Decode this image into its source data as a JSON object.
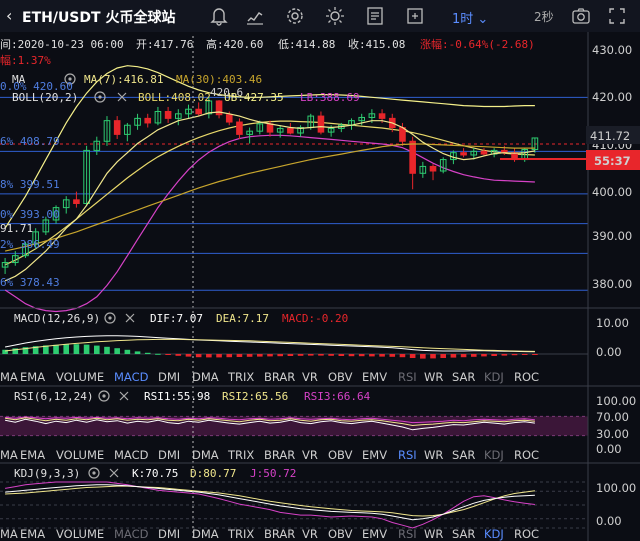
{
  "header": {
    "back_icon": "chevron-left-icon",
    "title": "ETH/USDT 火币全球站",
    "interval": "1时",
    "refresh": "2秒",
    "icons": [
      "bell-icon",
      "edit-icon",
      "chart-icon",
      "gear-icon",
      "brightness-icon",
      "list-icon",
      "fullscreen-icon",
      "camera-icon"
    ]
  },
  "info": {
    "datetime": "间:2020-10-23 06:00",
    "open": "开:417.76",
    "high": "高:420.60",
    "low": "低:414.88",
    "close": "收:415.08",
    "change": "涨幅:-0.64%(-2.68)",
    "amplitude": "幅:1.37%"
  },
  "legend": {
    "ma_label": "MA",
    "ma7": "MA(7):416.81",
    "ma30": "MA(30):403.46",
    "boll_label": "BOLL(20,2)",
    "boll": "BOLL:408.02",
    "ub": "UB:427.35",
    "lb": "LB:388.69",
    "fib": [
      "0.0% 420.60",
      "6% 408.79",
      "8% 399.51",
      "0% 393.00",
      "2% 386.49",
      "6% 378.43"
    ],
    "low_mark": "91.71",
    "high_mark": "420.6"
  },
  "price_axis": {
    "ticks": [
      "430.00",
      "420.00",
      "410.00",
      "400.00",
      "390.00",
      "380.00"
    ],
    "current": "411.72",
    "countdown": "55:37"
  },
  "macd": {
    "label": "MACD(12,26,9)",
    "dif": "DIF:7.07",
    "dea": "DEA:7.17",
    "macd": "MACD:-0.20",
    "ticks": [
      "10.00",
      "0.00"
    ]
  },
  "tabs": [
    "MA",
    "EMA",
    "VOLUME",
    "MACD",
    "DMI",
    "DMA",
    "TRIX",
    "BRAR",
    "VR",
    "OBV",
    "EMV",
    "RSI",
    "WR",
    "SAR",
    "KDJ",
    "ROC"
  ],
  "rsi": {
    "label": "RSI(6,12,24)",
    "rsi1": "RSI1:55.98",
    "rsi2": "RSI2:65.56",
    "rsi3": "RSI3:66.64",
    "ticks": [
      "100.00",
      "70.00",
      "30.00",
      "0.00"
    ]
  },
  "kdj": {
    "label": "KDJ(9,3,3)",
    "k": "K:70.75",
    "d": "D:80.77",
    "j": "J:50.72",
    "ticks": [
      "100.00",
      "0.00"
    ]
  },
  "colors": {
    "up": "#2ecc71",
    "down": "#e8262b",
    "ma7": "#f0e68c",
    "ma30": "#c7a52d",
    "boll": "#e8d86a",
    "ub": "#f5f08a",
    "lb": "#d642c7",
    "fib": "#2f5fd0",
    "accent": "#5a8dff"
  },
  "chart_data": {
    "type": "candlestick",
    "ylim": [
      375,
      434
    ],
    "candles": [
      {
        "o": 383.5,
        "h": 385.5,
        "l": 382.0,
        "c": 384.5
      },
      {
        "o": 384.5,
        "h": 387.0,
        "l": 383.8,
        "c": 386.0
      },
      {
        "o": 386.0,
        "h": 389.0,
        "l": 385.5,
        "c": 388.5
      },
      {
        "o": 388.5,
        "h": 392.0,
        "l": 387.5,
        "c": 391.2
      },
      {
        "o": 391.2,
        "h": 394.5,
        "l": 390.5,
        "c": 393.8
      },
      {
        "o": 393.8,
        "h": 397.0,
        "l": 393.0,
        "c": 396.5
      },
      {
        "o": 396.5,
        "h": 399.0,
        "l": 395.2,
        "c": 398.2
      },
      {
        "o": 398.2,
        "h": 400.0,
        "l": 396.5,
        "c": 397.4
      },
      {
        "o": 397.4,
        "h": 410.0,
        "l": 396.8,
        "c": 409.0
      },
      {
        "o": 409.0,
        "h": 412.0,
        "l": 408.0,
        "c": 411.0
      },
      {
        "o": 411.0,
        "h": 416.5,
        "l": 410.0,
        "c": 415.5
      },
      {
        "o": 415.5,
        "h": 416.5,
        "l": 411.5,
        "c": 412.5
      },
      {
        "o": 412.5,
        "h": 415.0,
        "l": 411.0,
        "c": 414.5
      },
      {
        "o": 414.5,
        "h": 417.0,
        "l": 413.5,
        "c": 416.0
      },
      {
        "o": 416.0,
        "h": 417.0,
        "l": 414.0,
        "c": 415.0
      },
      {
        "o": 415.0,
        "h": 418.5,
        "l": 414.5,
        "c": 417.5
      },
      {
        "o": 417.5,
        "h": 418.5,
        "l": 415.0,
        "c": 416.0
      },
      {
        "o": 416.0,
        "h": 418.0,
        "l": 414.5,
        "c": 417.0
      },
      {
        "o": 417.0,
        "h": 419.0,
        "l": 416.0,
        "c": 418.0
      },
      {
        "o": 418.0,
        "h": 419.5,
        "l": 416.5,
        "c": 417.0
      },
      {
        "o": 417.0,
        "h": 420.6,
        "l": 416.0,
        "c": 419.8
      },
      {
        "o": 419.8,
        "h": 420.0,
        "l": 416.0,
        "c": 416.8
      },
      {
        "o": 416.8,
        "h": 417.5,
        "l": 414.5,
        "c": 415.2
      },
      {
        "o": 415.2,
        "h": 416.0,
        "l": 411.5,
        "c": 412.5
      },
      {
        "o": 412.5,
        "h": 414.0,
        "l": 410.5,
        "c": 413.2
      },
      {
        "o": 413.2,
        "h": 415.5,
        "l": 412.5,
        "c": 414.8
      },
      {
        "o": 414.8,
        "h": 415.5,
        "l": 412.0,
        "c": 413.0
      },
      {
        "o": 413.0,
        "h": 414.5,
        "l": 411.8,
        "c": 413.8
      },
      {
        "o": 413.8,
        "h": 415.0,
        "l": 412.5,
        "c": 412.8
      },
      {
        "o": 412.8,
        "h": 414.5,
        "l": 412.0,
        "c": 414.0
      },
      {
        "o": 414.0,
        "h": 417.0,
        "l": 413.5,
        "c": 416.5
      },
      {
        "o": 416.5,
        "h": 417.5,
        "l": 412.5,
        "c": 413.0
      },
      {
        "o": 413.0,
        "h": 414.5,
        "l": 412.0,
        "c": 413.8
      },
      {
        "o": 413.8,
        "h": 415.0,
        "l": 413.0,
        "c": 414.5
      },
      {
        "o": 414.5,
        "h": 416.0,
        "l": 413.5,
        "c": 415.5
      },
      {
        "o": 415.5,
        "h": 417.0,
        "l": 414.5,
        "c": 416.2
      },
      {
        "o": 416.2,
        "h": 418.0,
        "l": 415.0,
        "c": 417.0
      },
      {
        "o": 417.0,
        "h": 418.0,
        "l": 415.0,
        "c": 416.0
      },
      {
        "o": 416.0,
        "h": 417.0,
        "l": 413.0,
        "c": 414.0
      },
      {
        "o": 414.0,
        "h": 415.0,
        "l": 410.0,
        "c": 411.0
      },
      {
        "o": 411.0,
        "h": 412.0,
        "l": 400.5,
        "c": 404.0
      },
      {
        "o": 404.0,
        "h": 406.5,
        "l": 403.0,
        "c": 405.5
      },
      {
        "o": 405.5,
        "h": 406.0,
        "l": 402.5,
        "c": 404.5
      },
      {
        "o": 404.5,
        "h": 407.5,
        "l": 404.0,
        "c": 407.0
      },
      {
        "o": 407.0,
        "h": 409.0,
        "l": 406.0,
        "c": 408.5
      },
      {
        "o": 408.5,
        "h": 409.5,
        "l": 407.5,
        "c": 408.0
      },
      {
        "o": 408.0,
        "h": 409.5,
        "l": 407.0,
        "c": 408.8
      },
      {
        "o": 408.8,
        "h": 409.5,
        "l": 407.8,
        "c": 408.2
      },
      {
        "o": 408.2,
        "h": 409.5,
        "l": 407.5,
        "c": 409.0
      },
      {
        "o": 409.0,
        "h": 410.0,
        "l": 408.0,
        "c": 408.5
      },
      {
        "o": 408.5,
        "h": 409.5,
        "l": 406.5,
        "c": 407.0
      },
      {
        "o": 407.0,
        "h": 409.5,
        "l": 406.5,
        "c": 409.2
      },
      {
        "o": 409.2,
        "h": 411.72,
        "l": 408.5,
        "c": 411.72
      }
    ],
    "ma7": [
      380.5,
      381.5,
      383.0,
      385.0,
      387.0,
      389.5,
      392.0,
      394.0,
      397.0,
      400.5,
      404.0,
      406.5,
      408.5,
      410.5,
      412.0,
      413.5,
      414.5,
      415.5,
      416.0,
      416.5,
      417.2,
      417.4,
      417.0,
      416.5,
      415.8,
      415.2,
      414.8,
      414.4,
      414.0,
      413.8,
      414.0,
      414.2,
      414.0,
      414.2,
      414.5,
      415.0,
      415.5,
      415.5,
      415.0,
      414.0,
      412.5,
      410.8,
      409.5,
      408.3,
      407.5,
      407.0,
      407.2,
      407.8,
      408.3,
      408.5,
      408.4,
      408.5,
      408.9
    ],
    "ma30": [
      387.0,
      387.5,
      388.0,
      388.6,
      389.2,
      389.8,
      390.5,
      391.2,
      392.0,
      392.8,
      393.6,
      394.4,
      395.2,
      396.0,
      396.8,
      397.6,
      398.4,
      399.2,
      400.0,
      400.8,
      401.5,
      402.2,
      402.8,
      403.4,
      404.0,
      404.5,
      405.0,
      405.5,
      406.0,
      406.5,
      407.0,
      407.4,
      407.8,
      408.2,
      408.6,
      409.0,
      409.4,
      409.8,
      410.1,
      410.3,
      410.4,
      410.4,
      410.3,
      410.2,
      410.1,
      410.0,
      409.9,
      409.8,
      409.7,
      409.6,
      409.5,
      409.5,
      409.5
    ],
    "ub": [
      392.0,
      395.5,
      399.0,
      403.0,
      407.0,
      411.0,
      415.0,
      418.5,
      421.5,
      424.0,
      425.8,
      427.0,
      427.5,
      427.3,
      426.8,
      426.0,
      425.0,
      424.0,
      423.0,
      422.2,
      421.6,
      421.2,
      420.9,
      420.7,
      420.6,
      420.6,
      420.7,
      420.8,
      420.9,
      421.0,
      421.1,
      421.2,
      421.2,
      421.1,
      421.0,
      420.8,
      420.6,
      420.4,
      420.2,
      420.0,
      419.8,
      419.6,
      419.4,
      419.2,
      419.0,
      418.8,
      418.7,
      418.6,
      418.6,
      418.6,
      418.7,
      418.8,
      418.8
    ],
    "boll": [
      384.0,
      385.0,
      386.2,
      387.5,
      389.0,
      390.6,
      392.3,
      394.0,
      395.8,
      397.6,
      399.4,
      401.2,
      403.0,
      404.6,
      406.2,
      407.6,
      408.8,
      409.9,
      410.9,
      411.8,
      412.6,
      413.3,
      413.9,
      414.4,
      414.8,
      415.1,
      415.3,
      415.4,
      415.4,
      415.3,
      415.2,
      415.1,
      414.9,
      414.7,
      414.5,
      414.3,
      414.1,
      413.9,
      413.6,
      413.3,
      412.9,
      412.4,
      411.8,
      411.2,
      410.6,
      410.0,
      409.5,
      409.0,
      408.7,
      408.4,
      408.2,
      408.1,
      408.0
    ],
    "lb": [
      378.5,
      377.0,
      375.5,
      374.5,
      374.0,
      373.8,
      374.0,
      374.5,
      375.5,
      377.0,
      379.5,
      382.5,
      386.0,
      389.5,
      393.0,
      396.5,
      399.5,
      402.3,
      404.8,
      406.9,
      408.6,
      409.9,
      410.9,
      411.6,
      412.0,
      412.2,
      412.3,
      412.3,
      412.2,
      412.0,
      411.8,
      411.6,
      411.4,
      411.2,
      411.0,
      410.8,
      410.6,
      410.4,
      410.1,
      409.6,
      408.6,
      407.4,
      406.2,
      405.2,
      404.4,
      403.7,
      403.2,
      402.8,
      402.5,
      402.4,
      402.3,
      402.2,
      402.1
    ],
    "fib_levels": [
      420.6,
      408.79,
      399.51,
      393.0,
      386.49,
      378.43
    ],
    "macd_range": [
      -4,
      13
    ],
    "macd_hist": [
      2.1,
      2.8,
      3.4,
      3.9,
      4.3,
      4.6,
      4.8,
      4.9,
      4.7,
      4.2,
      3.6,
      2.9,
      2.1,
      1.3,
      0.6,
      0.1,
      -0.4,
      -0.9,
      -1.3,
      -1.6,
      -1.7,
      -1.7,
      -1.6,
      -1.5,
      -1.4,
      -1.3,
      -1.2,
      -1.1,
      -1.0,
      -0.9,
      -0.8,
      -0.8,
      -0.9,
      -1.0,
      -1.1,
      -1.1,
      -1.2,
      -1.3,
      -1.4,
      -1.6,
      -2.0,
      -2.3,
      -2.2,
      -2.0,
      -1.8,
      -1.6,
      -1.4,
      -1.2,
      -1.0,
      -0.8,
      -0.6,
      -0.4,
      -0.2
    ],
    "dif": [
      3.5,
      4.5,
      5.5,
      6.3,
      7.0,
      7.6,
      8.1,
      8.5,
      8.8,
      9.0,
      9.1,
      9.1,
      9.0,
      8.8,
      8.5,
      8.2,
      7.9,
      7.6,
      7.3,
      7.0,
      6.8,
      6.6,
      6.4,
      6.2,
      6.0,
      5.8,
      5.6,
      5.4,
      5.2,
      5.0,
      4.8,
      4.6,
      4.4,
      4.2,
      4.0,
      3.8,
      3.6,
      3.4,
      3.1,
      2.7,
      2.2,
      1.8,
      1.6,
      1.5,
      1.5,
      1.5,
      1.6,
      1.6,
      1.5,
      1.4,
      1.3,
      1.2,
      1.1
    ],
    "dea": [
      1.5,
      2.1,
      2.7,
      3.3,
      3.9,
      4.4,
      4.9,
      5.3,
      5.7,
      6.1,
      6.4,
      6.7,
      6.9,
      7.1,
      7.2,
      7.3,
      7.3,
      7.3,
      7.2,
      7.1,
      7.0,
      6.9,
      6.8,
      6.7,
      6.6,
      6.4,
      6.2,
      6.0,
      5.8,
      5.6,
      5.4,
      5.2,
      5.0,
      4.8,
      4.6,
      4.4,
      4.2,
      4.0,
      3.8,
      3.6,
      3.4,
      3.1,
      2.9,
      2.7,
      2.5,
      2.3,
      2.1,
      1.9,
      1.8,
      1.6,
      1.5,
      1.4,
      1.3
    ],
    "rsi1": [
      62,
      58,
      64,
      60,
      55,
      60,
      57,
      62,
      58,
      63,
      59,
      61,
      56,
      60,
      58,
      62,
      57,
      55,
      60,
      58,
      62,
      59,
      56,
      54,
      57,
      60,
      56,
      58,
      62,
      57,
      55,
      59,
      61,
      57,
      55,
      58,
      60,
      56,
      52,
      48,
      42,
      45,
      47,
      50,
      53,
      52,
      55,
      58,
      56,
      54,
      57,
      59,
      56
    ],
    "rsi2": [
      66,
      63,
      67,
      64,
      61,
      64,
      62,
      65,
      63,
      66,
      63,
      65,
      62,
      64,
      63,
      65,
      62,
      61,
      64,
      62,
      65,
      63,
      61,
      59,
      62,
      64,
      61,
      62,
      65,
      62,
      60,
      63,
      64,
      61,
      60,
      62,
      63,
      61,
      58,
      55,
      51,
      53,
      54,
      56,
      58,
      57,
      59,
      61,
      60,
      59,
      61,
      62,
      60
    ],
    "rsi3": [
      68,
      66,
      69,
      67,
      65,
      67,
      66,
      68,
      66,
      68,
      66,
      67,
      65,
      67,
      66,
      67,
      65,
      64,
      66,
      65,
      67,
      66,
      64,
      63,
      65,
      66,
      64,
      65,
      67,
      65,
      64,
      65,
      66,
      64,
      63,
      65,
      66,
      64,
      62,
      60,
      57,
      58,
      59,
      60,
      62,
      61,
      63,
      64,
      63,
      62,
      64,
      65,
      63
    ],
    "kdj_k": [
      78,
      80,
      82,
      84,
      86,
      88,
      90,
      92,
      93,
      94,
      94,
      93,
      92,
      90,
      88,
      86,
      84,
      82,
      80,
      78,
      75,
      72,
      68,
      64,
      60,
      56,
      52,
      48,
      45,
      42,
      40,
      38,
      36,
      35,
      34,
      33,
      32,
      30,
      26,
      22,
      18,
      20,
      24,
      30,
      38,
      46,
      54,
      60,
      64,
      67,
      69,
      70,
      71
    ],
    "kdj_d": [
      74,
      75,
      76,
      78,
      80,
      82,
      84,
      86,
      88,
      89,
      90,
      91,
      91,
      90,
      89,
      88,
      86,
      84,
      82,
      80,
      78,
      76,
      73,
      70,
      66,
      62,
      58,
      55,
      52,
      49,
      46,
      44,
      42,
      40,
      38,
      37,
      36,
      35,
      33,
      30,
      27,
      26,
      27,
      30,
      35,
      40,
      47,
      55,
      63,
      70,
      75,
      78,
      81
    ],
    "kdj_j": [
      86,
      90,
      94,
      96,
      98,
      100,
      100,
      100,
      100,
      100,
      100,
      97,
      94,
      90,
      86,
      82,
      80,
      78,
      76,
      74,
      69,
      64,
      58,
      52,
      48,
      44,
      40,
      34,
      31,
      28,
      28,
      26,
      24,
      25,
      26,
      25,
      24,
      20,
      12,
      6,
      0,
      8,
      18,
      30,
      44,
      58,
      68,
      70,
      66,
      61,
      57,
      54,
      51
    ]
  }
}
